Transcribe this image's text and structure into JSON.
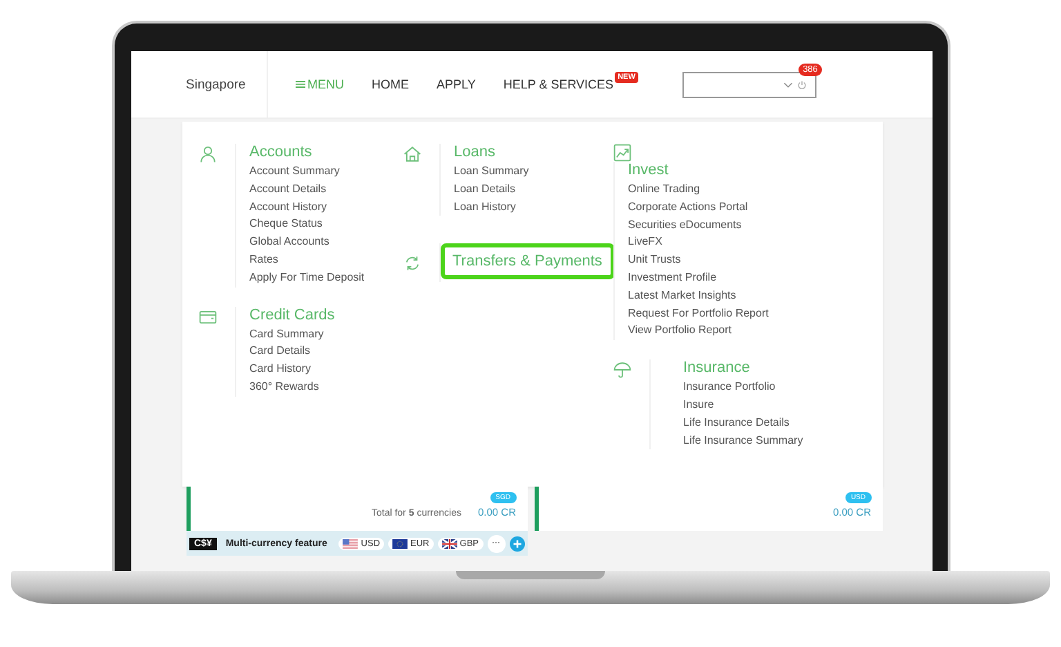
{
  "nav": {
    "location": "Singapore",
    "items": [
      {
        "label": "MENU",
        "kind": "menu",
        "selected": true
      },
      {
        "label": "HOME",
        "kind": "link",
        "selected": false
      },
      {
        "label": "APPLY",
        "kind": "link",
        "selected": false
      },
      {
        "label": "HELP & SERVICES",
        "kind": "link",
        "selected": false,
        "badge": "NEW"
      }
    ],
    "notification_count": "386"
  },
  "menu": {
    "columns": [
      {
        "sections": [
          {
            "title": "Accounts",
            "highlighted": false,
            "links": [
              "Account Summary",
              "Account Details",
              "Account History",
              "Cheque Status",
              "Global Accounts",
              "Rates",
              "Apply For Time Deposit"
            ]
          },
          {
            "title": "Credit Cards",
            "highlighted": false,
            "links": [
              "Card Summary",
              "Card Details",
              "Card History",
              "360° Rewards"
            ]
          }
        ]
      },
      {
        "sections": [
          {
            "title": "Loans",
            "highlighted": false,
            "links": [
              "Loan Summary",
              "Loan Details",
              "Loan History"
            ]
          },
          {
            "title": "Transfers & Payments",
            "highlighted": true
          }
        ]
      },
      {
        "sections": [
          {
            "title": "Invest",
            "highlighted": false,
            "links": [
              "Online Trading",
              "Corporate Actions Portal",
              "Securities eDocuments",
              "LiveFX",
              "Unit Trusts",
              "Investment Profile",
              "Latest Market Insights",
              "Request For Portfolio Report",
              "View Portfolio Report"
            ]
          },
          {
            "title": "Insurance",
            "highlighted": false,
            "links": [
              "Insurance Portfolio",
              "Insure",
              "Life Insurance Details",
              "Life Insurance Summary"
            ]
          }
        ]
      }
    ]
  },
  "balances": [
    {
      "currency": "SGD",
      "label": "Total for **5** currencies",
      "amount": "0.00 CR"
    },
    {
      "currency": "USD",
      "amount": "0.00 CR"
    }
  ],
  "multi_currency": {
    "logo": "C$¥",
    "text": "Multi-currency feature",
    "chips": [
      {
        "label": "USD"
      },
      {
        "label": "EUR"
      },
      {
        "label": "GBP"
      }
    ],
    "more": "···"
  }
}
